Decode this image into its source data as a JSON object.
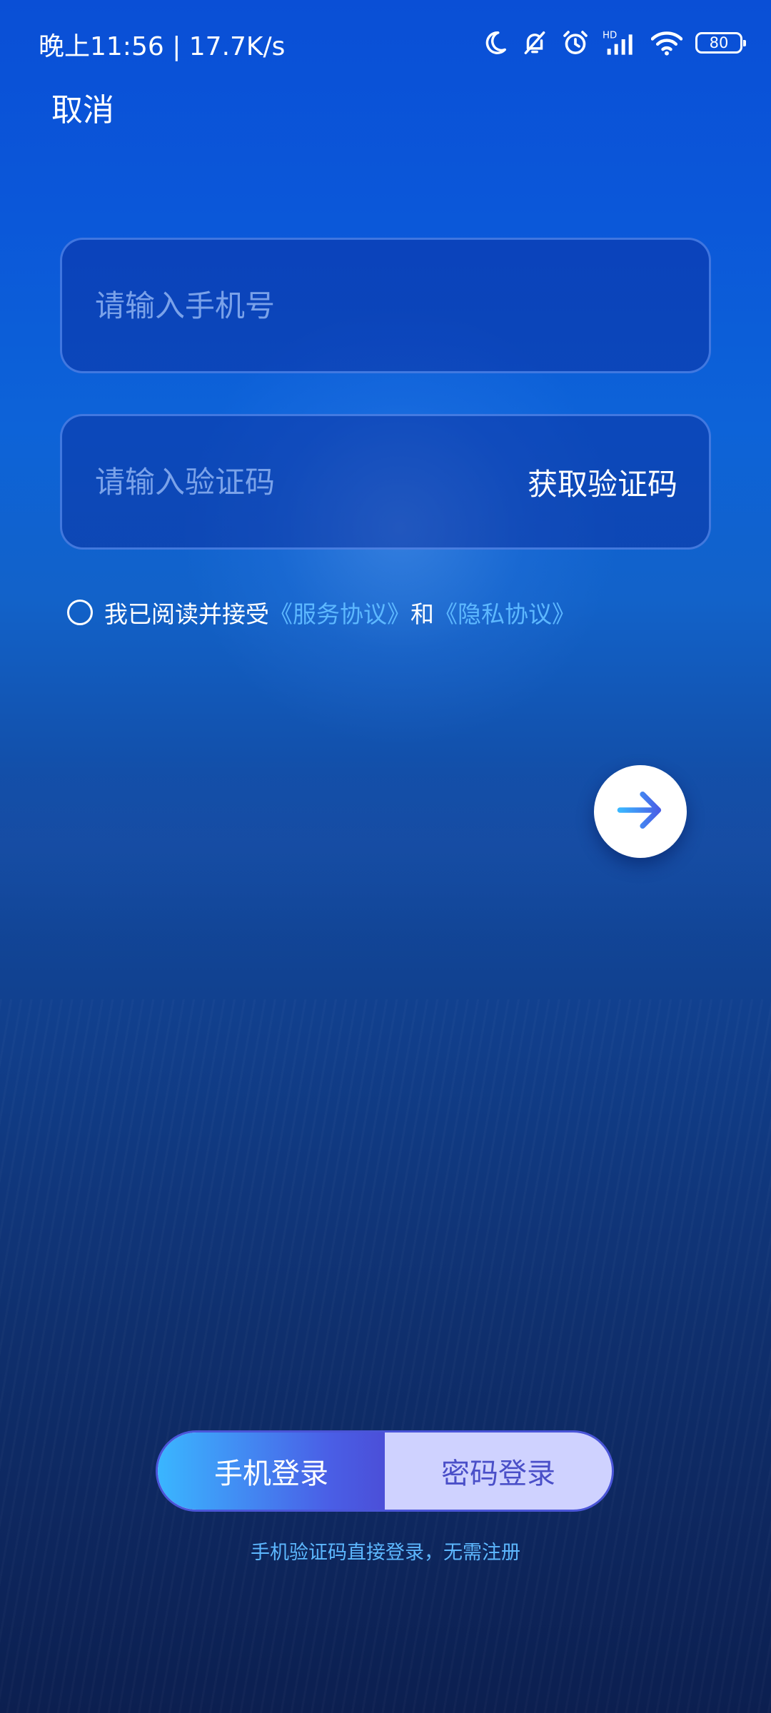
{
  "status_bar": {
    "time_speed": "晚上11:56 | 17.7K/s",
    "battery": "80",
    "icons": [
      "moon-icon",
      "bell-off-icon",
      "alarm-icon",
      "hd-signal-icon",
      "wifi-icon",
      "battery-icon"
    ]
  },
  "header": {
    "cancel_label": "取消"
  },
  "form": {
    "phone_placeholder": "请输入手机号",
    "code_placeholder": "请输入验证码",
    "get_code_label": "获取验证码"
  },
  "agreement": {
    "prefix": "我已阅读并接受",
    "service_link": "《服务协议》",
    "conjunction": "和",
    "privacy_link": "《隐私协议》"
  },
  "next_button_icon": "arrow-right-icon",
  "login_mode": {
    "phone_label": "手机登录",
    "password_label": "密码登录",
    "selected": "手机登录"
  },
  "hint": "手机验证码直接登录，无需注册",
  "colors": {
    "link": "#5db8ff",
    "toggle_active_start": "#3ab6ff",
    "toggle_active_end": "#4b4fd8",
    "toggle_inactive_bg": "#cfd2ff"
  }
}
